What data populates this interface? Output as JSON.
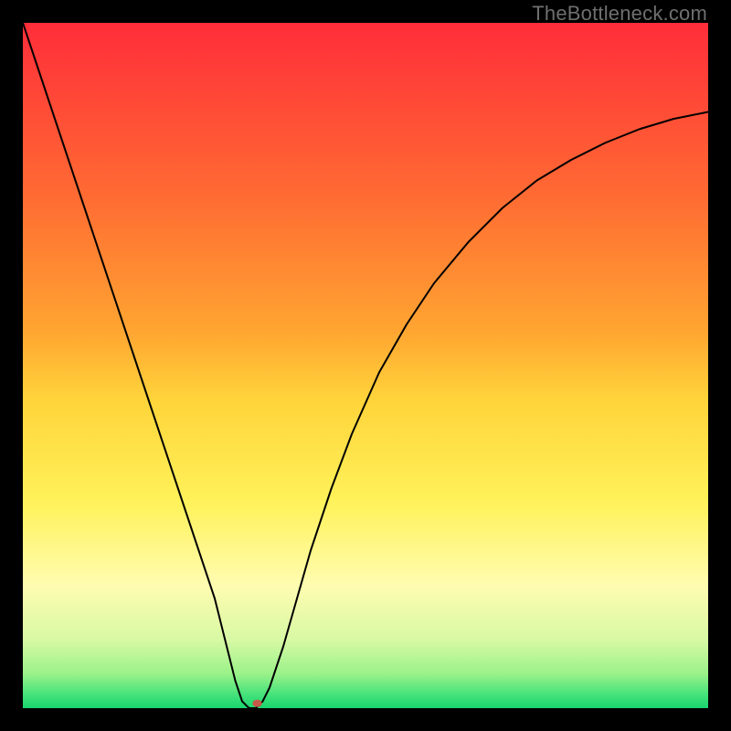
{
  "watermark": "TheBottleneck.com",
  "chart_data": {
    "type": "line",
    "title": "",
    "xlabel": "",
    "ylabel": "",
    "xlim": [
      0,
      100
    ],
    "ylim": [
      0,
      100
    ],
    "background_gradient": {
      "stops": [
        {
          "offset": 0.0,
          "color": "#ff2d3a"
        },
        {
          "offset": 0.25,
          "color": "#ff6a33"
        },
        {
          "offset": 0.45,
          "color": "#ffa531"
        },
        {
          "offset": 0.55,
          "color": "#ffd43a"
        },
        {
          "offset": 0.7,
          "color": "#fff25a"
        },
        {
          "offset": 0.82,
          "color": "#fffcb0"
        },
        {
          "offset": 0.9,
          "color": "#d8f9a5"
        },
        {
          "offset": 0.95,
          "color": "#9af289"
        },
        {
          "offset": 0.98,
          "color": "#46e27b"
        },
        {
          "offset": 1.0,
          "color": "#18d66e"
        }
      ]
    },
    "curve": {
      "description": "Bottleneck curve: sharp V near x≈33 falling to y=0 then rising smoothly toward upper right",
      "x": [
        0,
        2,
        4,
        6,
        8,
        10,
        12,
        14,
        16,
        18,
        20,
        22,
        24,
        26,
        28,
        30,
        31,
        32,
        33,
        34,
        35,
        36,
        38,
        40,
        42,
        45,
        48,
        52,
        56,
        60,
        65,
        70,
        75,
        80,
        85,
        90,
        95,
        100
      ],
      "y": [
        100,
        94,
        88,
        82,
        76,
        70,
        64,
        58,
        52,
        46,
        40,
        34,
        28,
        22,
        16,
        8,
        4,
        1,
        0,
        0,
        1,
        3,
        9,
        16,
        23,
        32,
        40,
        49,
        56,
        62,
        68,
        73,
        77,
        80,
        82.5,
        84.5,
        86,
        87
      ]
    },
    "marker": {
      "x": 34.2,
      "y": 0.7,
      "color": "#c45a47",
      "rx": 5.2,
      "ry": 4
    }
  }
}
